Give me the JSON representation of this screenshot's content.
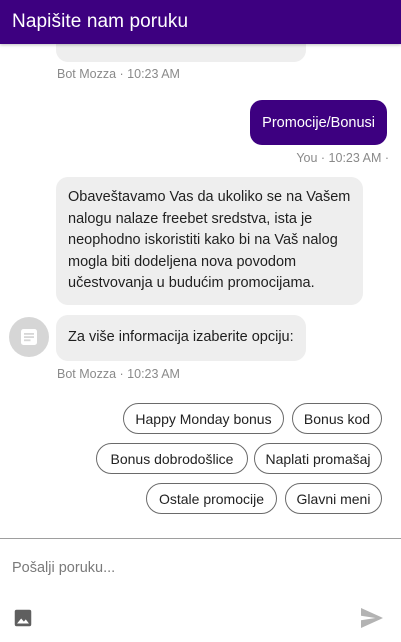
{
  "header": {
    "title": "Napišite nam poruku"
  },
  "messages": {
    "top_bot_meta": "Bot Mozza · 10:23 AM",
    "user_message": "Promocije/Bonusi",
    "user_meta": "You · 10:23 AM ·",
    "bot_info": "Obaveštavamo Vas da ukoliko se na Vašem nalogu nalaze freebet sredstva, ista je neophodno iskoristiti kako bi na Vaš nalog mogla biti dodeljena nova povodom učestvovanja u budućim promocijama.",
    "bot_prompt": "Za više informacija izaberite opciju:",
    "bot_meta": "Bot Mozza · 10:23 AM"
  },
  "quick_replies": {
    "happy_monday": "Happy Monday bonus",
    "bonus_kod": "Bonus kod",
    "bonus_dobrodoslice": "Bonus dobrodošlice",
    "naplati_promasaj": "Naplati promašaj",
    "ostale_promocije": "Ostale promocije",
    "glavni_meni": "Glavni meni"
  },
  "composer": {
    "placeholder": "Pošalji poruku..."
  },
  "icons": {
    "avatar": "document-icon",
    "attach": "image-icon",
    "send": "send-icon"
  },
  "colors": {
    "brand": "#3d0080",
    "bot_bubble": "#eeeeee",
    "meta_text": "#8a8a8a"
  }
}
